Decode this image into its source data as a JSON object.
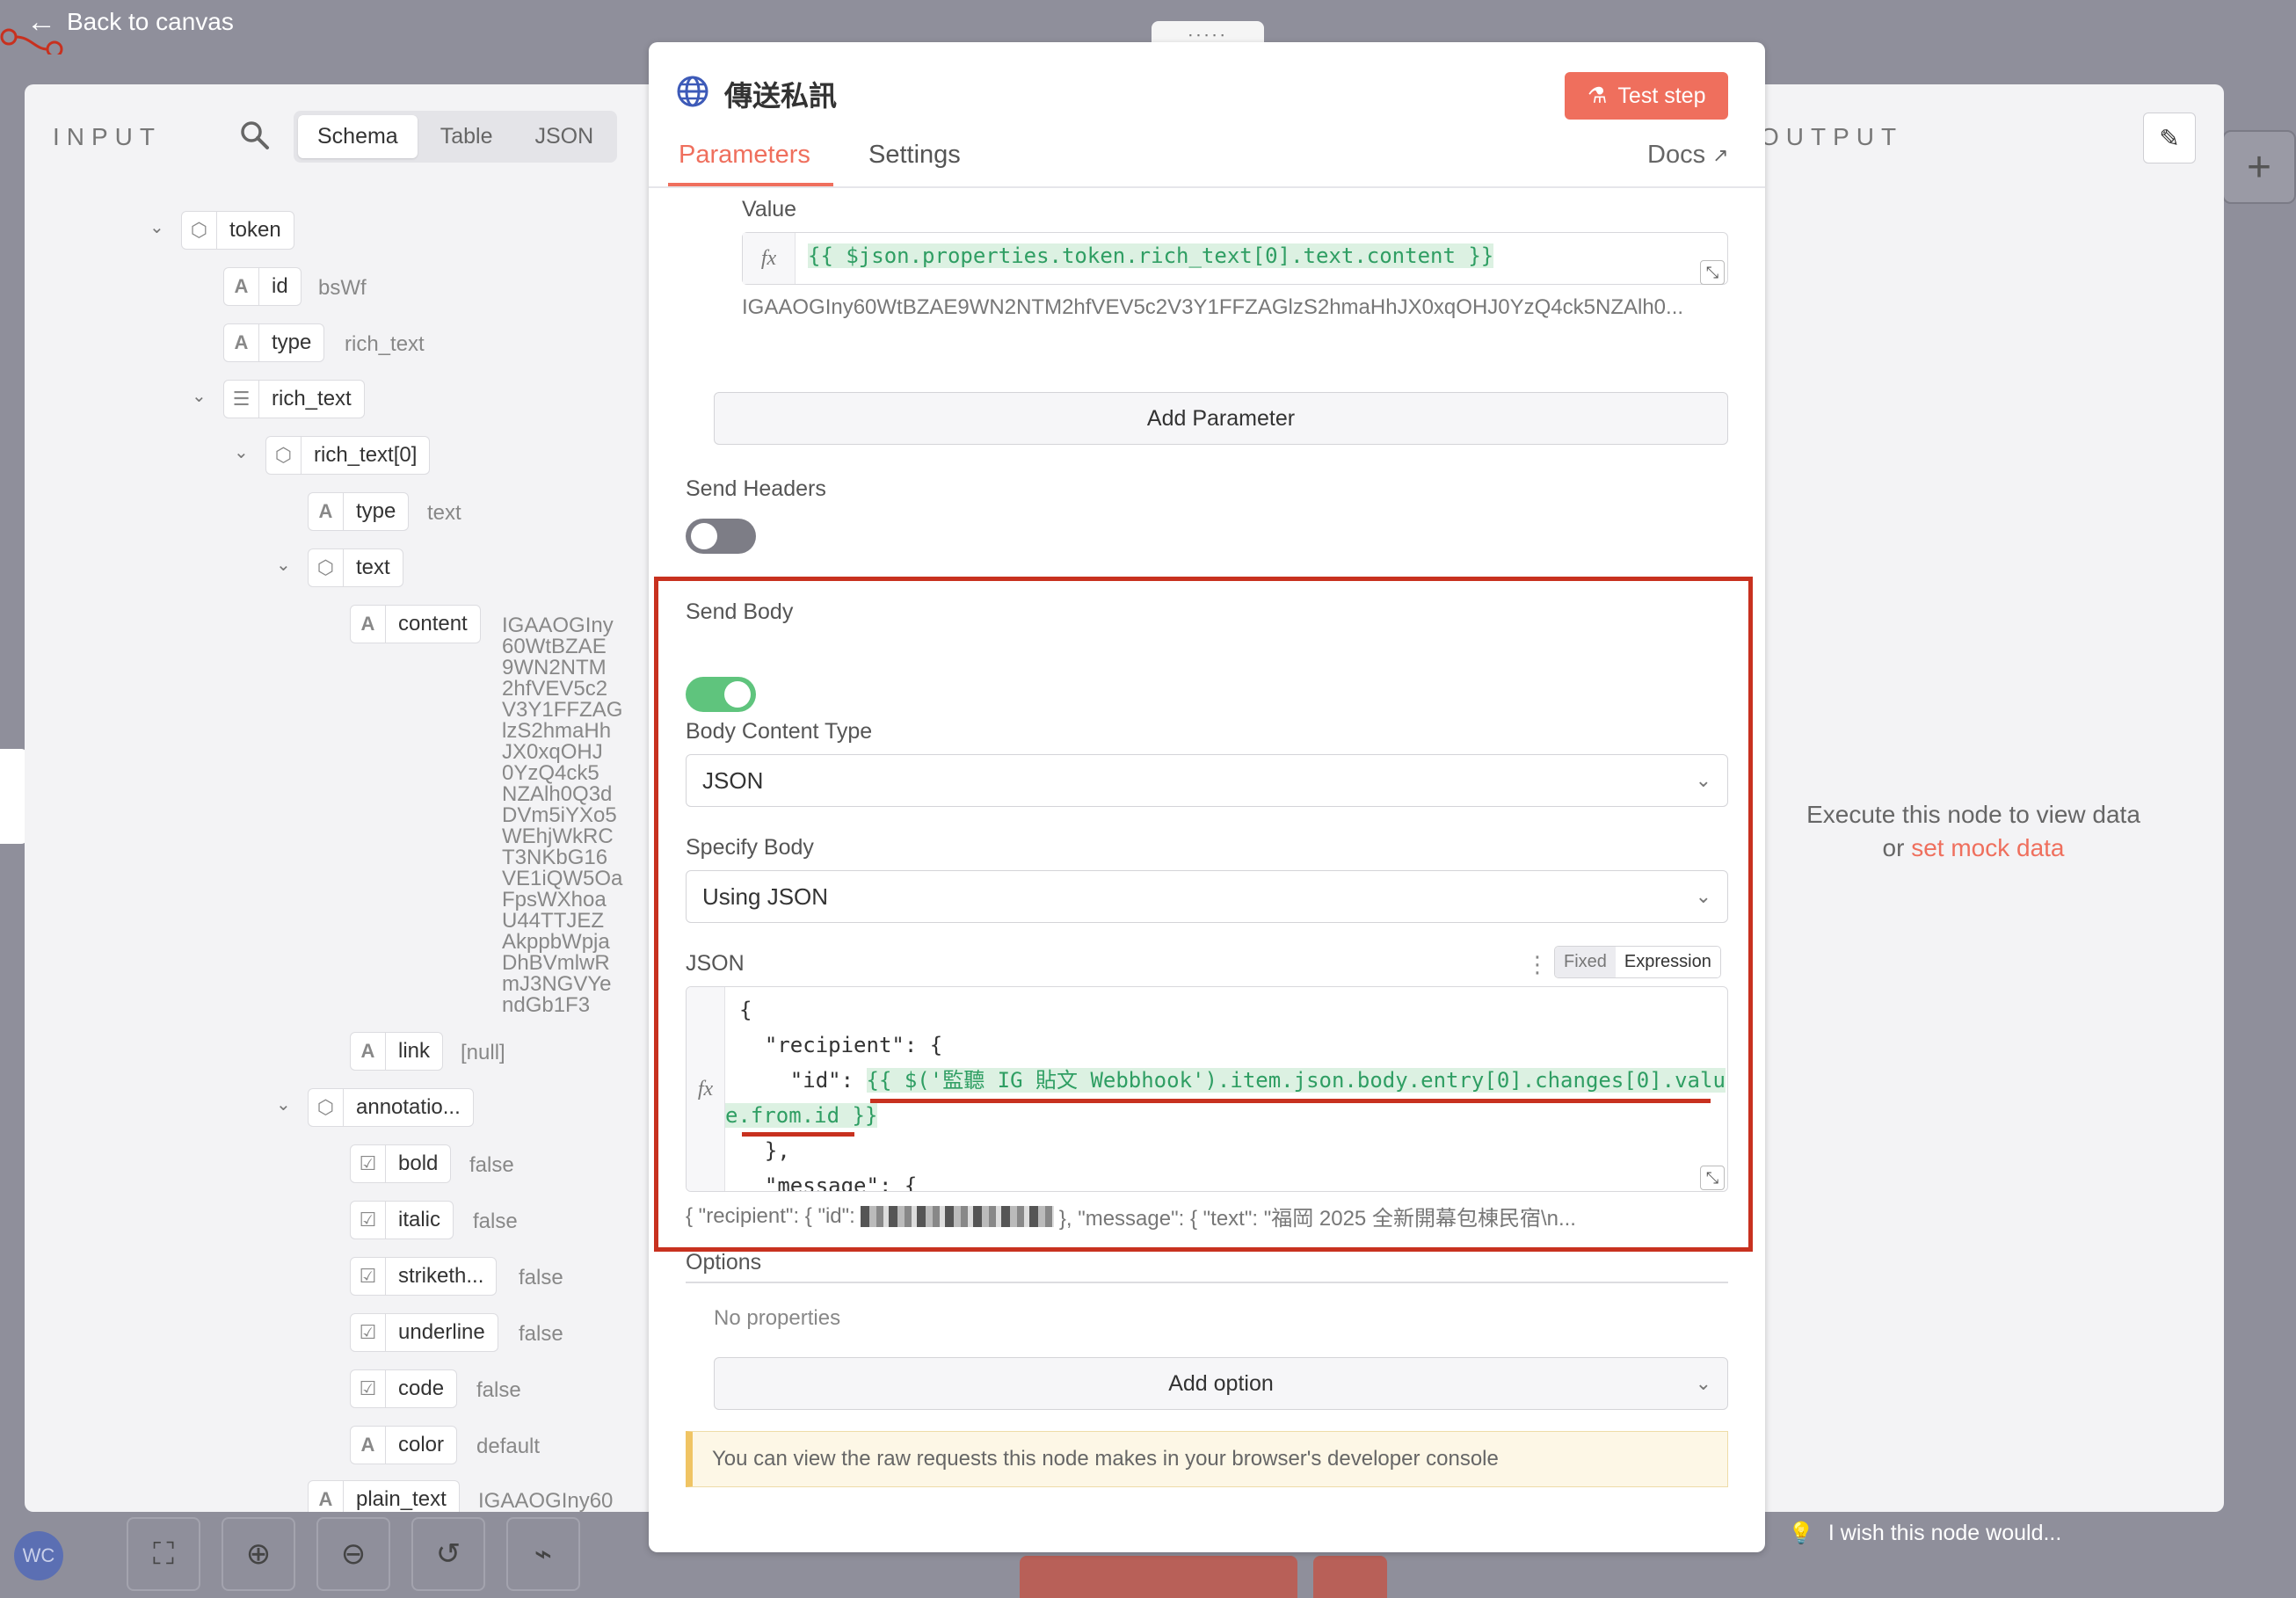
{
  "topbar": {
    "back_label": "Back to canvas",
    "handle": ":::::"
  },
  "input": {
    "title": "INPUT",
    "tabs": [
      {
        "label": "Schema"
      },
      {
        "label": "Table"
      },
      {
        "label": "JSON"
      }
    ],
    "tree": {
      "token": "token",
      "id": {
        "key": "id",
        "value": "bsWf"
      },
      "type": {
        "key": "type",
        "value": "rich_text"
      },
      "rich_text": "rich_text",
      "rich_text0": "rich_text[0]",
      "type2": {
        "key": "type",
        "value": "text"
      },
      "text": "text",
      "content": {
        "key": "content",
        "value_lines": [
          "IGAAOGIny",
          "60WtBZAE",
          "9WN2NTM",
          "2hfVEV5c2",
          "V3Y1FFZAG",
          "lzS2hmaHh",
          "JX0xqOHJ",
          "0YzQ4ck5",
          "NZAlh0Q3d",
          "DVm5iYXo5",
          "WEhjWkRC",
          "T3NKbG16",
          "VE1iQW5Oa",
          "FpsWXhoa",
          "U44TTJEZ",
          "AkppbWpja",
          "DhBVmlwR",
          "mJ3NGVYe",
          "ndGb1F3"
        ]
      },
      "link": {
        "key": "link",
        "value": "[null]"
      },
      "annotations": "annotatio...",
      "bold": {
        "key": "bold",
        "value": "false"
      },
      "italic": {
        "key": "italic",
        "value": "false"
      },
      "strikethrough": {
        "key": "striketh...",
        "value": "false"
      },
      "underline": {
        "key": "underline",
        "value": "false"
      },
      "code": {
        "key": "code",
        "value": "false"
      },
      "color": {
        "key": "color",
        "value": "default"
      },
      "plain_text": {
        "key": "plain_text",
        "value": "IGAAOGIny60"
      }
    }
  },
  "modal": {
    "title": "傳送私訊",
    "test_step": "Test step",
    "tabs": {
      "parameters": "Parameters",
      "settings": "Settings",
      "docs": "Docs"
    },
    "value_label": "Value",
    "value_expression": "{{ $json.properties.token.rich_text[0].text.content }}",
    "value_preview": "IGAAOGIny60WtBZAE9WN2NTM2hfVEV5c2V3Y1FFZAGlzS2hmaHhJX0xqOHJ0YzQ4ck5NZAlh0...",
    "add_parameter": "Add Parameter",
    "send_headers_label": "Send Headers",
    "send_body_label": "Send Body",
    "body_content_type_label": "Body Content Type",
    "body_content_type_value": "JSON",
    "specify_body_label": "Specify Body",
    "specify_body_value": "Using JSON",
    "json_label": "JSON",
    "mode_fixed": "Fixed",
    "mode_expression": "Expression",
    "json_lines": {
      "l1": "{",
      "l2": "  \"recipient\": {",
      "l3_prefix": "    \"id\": ",
      "l3_expr": "{{ $('監聽 IG 貼文 Webbhook').item.json.body.entry[0].changes[0].valu",
      "l4_expr": "e.from.id }}",
      "l5": "  },",
      "l6": "  \"message\": {"
    },
    "json_preview_a": "{   \"recipient\": {     \"id\": ",
    "json_preview_b": "  },   \"message\": {     \"text\": \"福岡 2025 全新開幕包棟民宿\\n...",
    "options_label": "Options",
    "no_properties": "No properties",
    "add_option": "Add option",
    "info_text": "You can view the raw requests this node makes in your browser's developer console"
  },
  "output": {
    "title": "OUTPUT",
    "execute_line": "Execute this node to view data",
    "or_text": "or",
    "mock_link": "set mock data"
  },
  "footer": {
    "feedback": "I wish this node would...",
    "avatar": "WC"
  },
  "colors": {
    "accent": "#ef6f5d",
    "toggle_on": "#5fc47d",
    "toggle_off": "#7d7d86",
    "highlight_red": "#c8311f"
  }
}
